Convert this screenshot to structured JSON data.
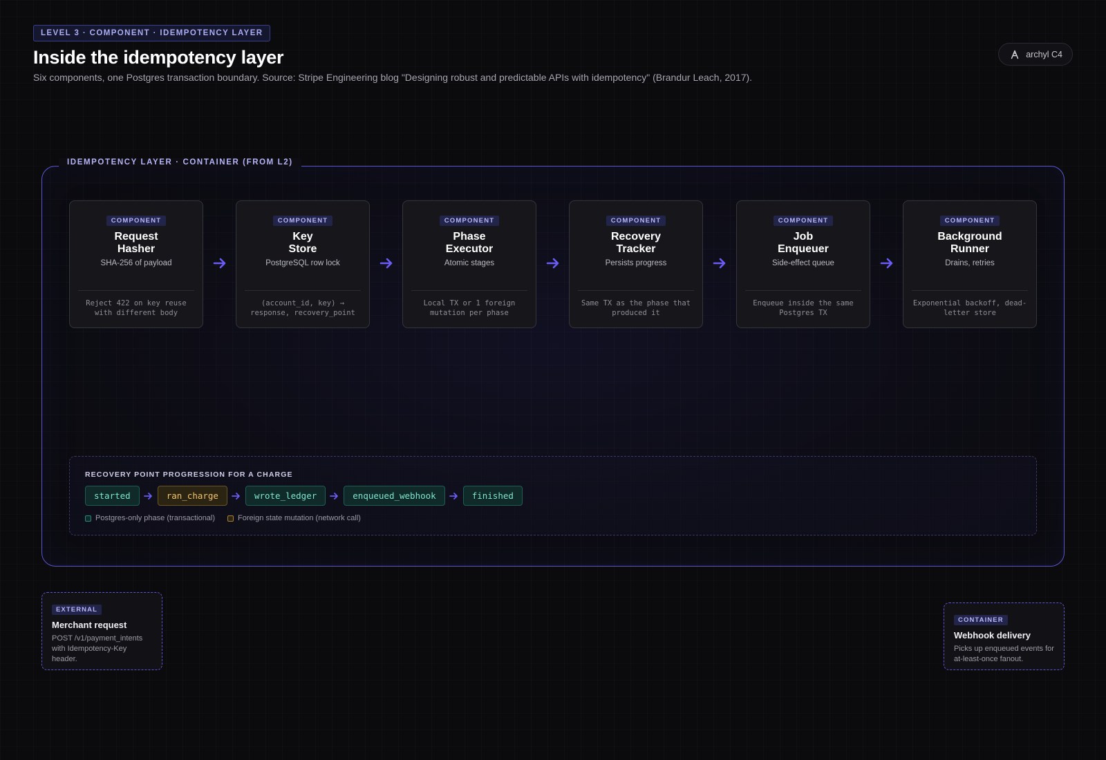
{
  "header": {
    "level_badge": "LEVEL 3 · COMPONENT · IDEMPOTENCY LAYER",
    "title": "Inside the idempotency layer",
    "subtitle": "Six components, one Postgres transaction boundary. Source: Stripe Engineering blog \"Designing robust and predictable APIs with idempotency\" (Brandur Leach, 2017).",
    "brand": "archyl C4"
  },
  "container": {
    "label": "IDEMPOTENCY LAYER · CONTAINER (FROM L2)"
  },
  "components": [
    {
      "tag": "COMPONENT",
      "name": "Request\nHasher",
      "desc": "SHA-256 of payload",
      "note": "Reject 422 on key reuse with different body"
    },
    {
      "tag": "COMPONENT",
      "name": "Key\nStore",
      "desc": "PostgreSQL row lock",
      "note": "(account_id, key) → response, recovery_point"
    },
    {
      "tag": "COMPONENT",
      "name": "Phase\nExecutor",
      "desc": "Atomic stages",
      "note": "Local TX or 1 foreign mutation per phase"
    },
    {
      "tag": "COMPONENT",
      "name": "Recovery\nTracker",
      "desc": "Persists progress",
      "note": "Same TX as the phase that produced it"
    },
    {
      "tag": "COMPONENT",
      "name": "Job\nEnqueuer",
      "desc": "Side-effect queue",
      "note": "Enqueue inside the same Postgres TX"
    },
    {
      "tag": "COMPONENT",
      "name": "Background\nRunner",
      "desc": "Drains, retries",
      "note": "Exponential backoff, dead-letter store"
    }
  ],
  "progression": {
    "title": "RECOVERY POINT PROGRESSION FOR A CHARGE",
    "steps": [
      {
        "label": "started",
        "kind": "postgres"
      },
      {
        "label": "ran_charge",
        "kind": "foreign"
      },
      {
        "label": "wrote_ledger",
        "kind": "postgres"
      },
      {
        "label": "enqueued_webhook",
        "kind": "postgres"
      },
      {
        "label": "finished",
        "kind": "postgres"
      }
    ],
    "legend": {
      "postgres": "Postgres-only phase (transactional)",
      "foreign": "Foreign state mutation (network call)"
    }
  },
  "external_left": {
    "tag": "EXTERNAL",
    "title": "Merchant request",
    "desc": "POST /v1/payment_intents with Idempotency-Key header."
  },
  "external_right": {
    "tag": "CONTAINER",
    "title": "Webhook delivery",
    "desc": "Picks up enqueued events for at-least-once fanout."
  },
  "colors": {
    "accent": "#6a5cf5",
    "frame": "#5a55d6",
    "postgres": "#7fe6cf",
    "foreign": "#f2c46a"
  }
}
